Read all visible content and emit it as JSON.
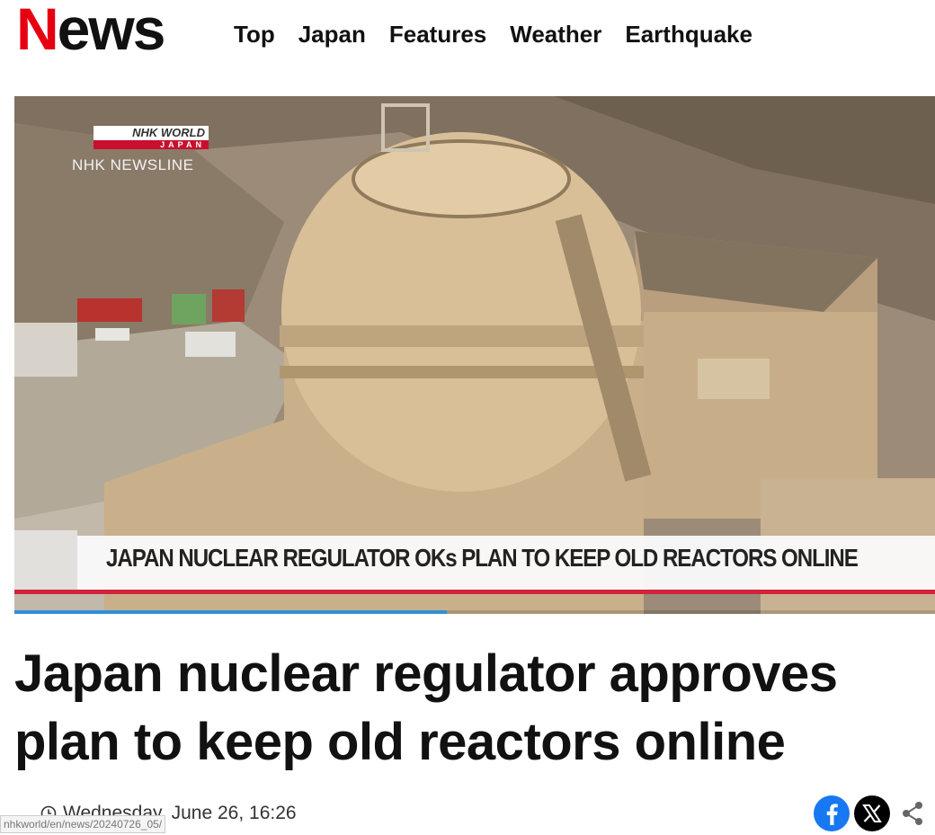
{
  "header": {
    "logo_initial": "N",
    "logo_rest": "ews",
    "nav": [
      {
        "label": "Top"
      },
      {
        "label": "Japan"
      },
      {
        "label": "Features"
      },
      {
        "label": "Weather"
      },
      {
        "label": "Earthquake"
      }
    ]
  },
  "video": {
    "badge_top": "NHK WORLD",
    "badge_bottom": "JAPAN",
    "channel": "NHK NEWSLINE",
    "caption": "JAPAN NUCLEAR REGULATOR OKs PLAN TO KEEP OLD REACTORS ONLINE",
    "progress": 0.47
  },
  "article": {
    "headline": "Japan nuclear regulator approves plan to keep old reactors online",
    "date": "Wednesday, June 26, 16:26",
    "status_url": "nhkworld/en/news/20240726_05/"
  },
  "share": {
    "icons": [
      "facebook-icon",
      "x-icon",
      "share-icon"
    ]
  },
  "colors": {
    "brand_red": "#e60012",
    "caption_red": "#d3233b",
    "progress_blue": "#2f8fd8",
    "facebook_blue": "#1877f2"
  }
}
